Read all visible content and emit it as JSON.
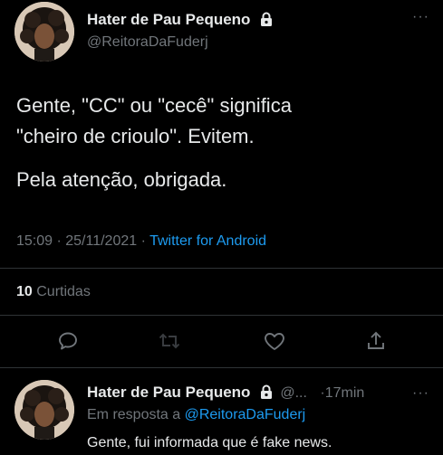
{
  "main_tweet": {
    "author_name": "Hater de Pau Pequeno",
    "author_handle": "@ReitoraDaFuderj",
    "more_label": "···",
    "text_line1": "Gente, \"CC\" ou \"cecê\" significa",
    "text_line2": "\"cheiro de crioulo\". Evitem.",
    "text_line3": "Pela atenção, obrigada.",
    "time": "15:09 · 25/11/2021 ·",
    "source": "Twitter for Android",
    "likes_count": "10",
    "likes_label": "Curtidas"
  },
  "actions": {
    "reply_icon": "comment-icon",
    "retweet_icon": "retweet-icon",
    "like_icon": "heart-icon",
    "share_icon": "share-icon"
  },
  "reply_tweet": {
    "author_name": "Hater de Pau Pequeno",
    "author_handle": "@...",
    "time": "·17min",
    "more_label": "···",
    "reply_prefix": "Em resposta a",
    "reply_to": "@ReitoraDaFuderj",
    "text": "Gente, fui informada que é fake news."
  },
  "colors": {
    "background": "#000000",
    "text": "#e7e9ea",
    "secondary": "#71767b",
    "accent": "#1d9bf0",
    "divider": "#2f3336"
  }
}
